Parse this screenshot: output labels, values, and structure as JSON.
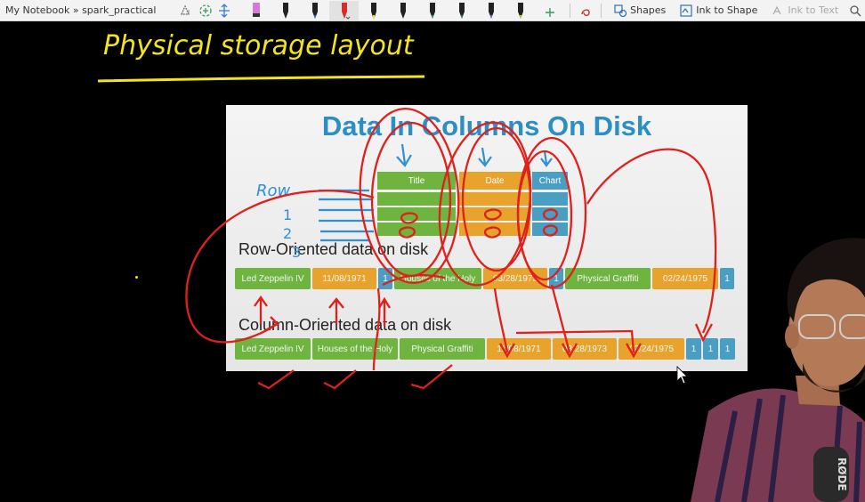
{
  "toolbar": {
    "breadcrumb": "My Notebook » spark_practical",
    "shapes_label": "Shapes",
    "ink_to_shape_label": "Ink to Shape",
    "ink_to_text_label": "Ink to Text",
    "pen_colors": [
      "#d37bd6",
      "#222222",
      "#2b6fd6",
      "#d92b2b",
      "#f2e000",
      "#222222",
      "#22a14c",
      "#2e7d32",
      "#6e7dd0",
      "#e9f000"
    ]
  },
  "note": {
    "handwritten_title": "Physical storage layout"
  },
  "slide": {
    "title": "Data In Columns On Disk",
    "headers": [
      "Title",
      "Date",
      "Chart"
    ],
    "row_label": "Row-Oriented data on disk",
    "col_label": "Column-Oriented data on disk",
    "row_blocks": [
      "Led Zeppelin IV",
      "11/08/1971",
      "1",
      "Houses of the Holy",
      "03/28/1973",
      "1",
      "Physical Graffiti",
      "02/24/1975",
      "1"
    ],
    "col_blocks": [
      "Led Zeppelin IV",
      "Houses of the Holy",
      "Physical Graffiti",
      "11/08/1971",
      "03/28/1973",
      "02/24/1975",
      "1",
      "1",
      "1"
    ]
  },
  "annotations": {
    "row_word": "Row",
    "row_numbers": [
      "1",
      "2",
      "3"
    ]
  },
  "webcam": {
    "mic_brand": "RØDE"
  }
}
